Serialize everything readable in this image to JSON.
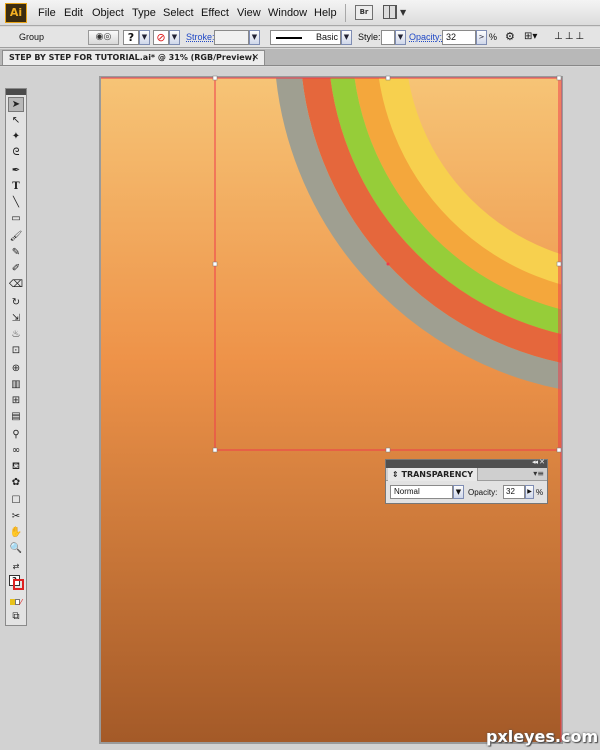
{
  "app": {
    "logo": "Ai"
  },
  "menu": [
    "File",
    "Edit",
    "Object",
    "Type",
    "Select",
    "Effect",
    "View",
    "Window",
    "Help"
  ],
  "bridge": {
    "label": "Br"
  },
  "control": {
    "selection": "Group",
    "fill_value": "?",
    "stroke_label": "Stroke:",
    "stroke_profile": "Basic",
    "style_label": "Style:",
    "opacity_label": "Opacity:",
    "opacity_value": "32",
    "percent": "%"
  },
  "document": {
    "tab_title": "STEP BY STEP FOR TUTORIAL.ai* @ 31% (RGB/Preview)",
    "close_glyph": "✕"
  },
  "transparency": {
    "title": "TRANSPARENCY",
    "blend_mode": "Normal",
    "opacity_label": "Opacity:",
    "opacity_value": "32",
    "percent": "%"
  },
  "colors": {
    "bg_top": "#f6c476",
    "bg_mid": "#ee9349",
    "bg_bottom": "#a45a28",
    "stripe_yellow": "#f7d04e",
    "stripe_orange": "#f4a73c",
    "stripe_green": "#96cd39",
    "stripe_red": "#e5673c",
    "stripe_gray": "#9f9f91",
    "selection": "#ef3b4b"
  },
  "watermark": "pxleyes.com"
}
